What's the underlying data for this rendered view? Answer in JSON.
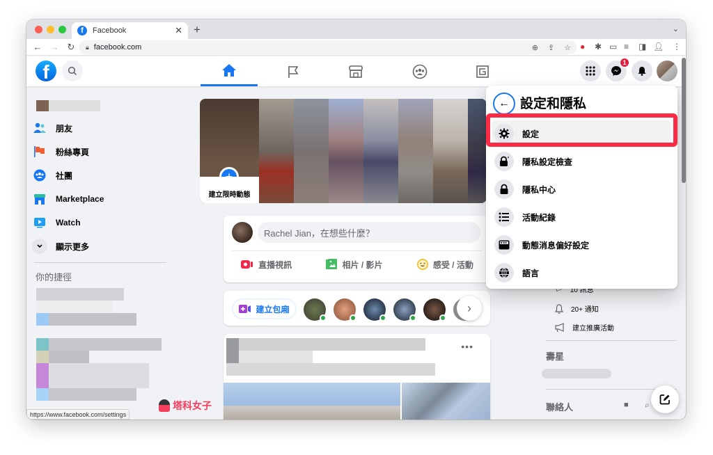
{
  "browser": {
    "tab_title": "Facebook",
    "url": "facebook.com",
    "status_url": "https://www.facebook.com/settings",
    "traffic_colors": [
      "#fe5f57",
      "#febc2e",
      "#28c840"
    ]
  },
  "header": {
    "nav_tabs": [
      {
        "name": "home",
        "active": true
      },
      {
        "name": "pages",
        "active": false
      },
      {
        "name": "marketplace",
        "active": false
      },
      {
        "name": "groups",
        "active": false
      },
      {
        "name": "gaming",
        "active": false
      }
    ],
    "messenger_badge": "1",
    "accent": "#1877f2"
  },
  "sidebar": {
    "items": [
      {
        "label": "朋友",
        "icon": "friends-icon"
      },
      {
        "label": "粉絲專頁",
        "icon": "flag-icon"
      },
      {
        "label": "社團",
        "icon": "groups-icon"
      },
      {
        "label": "Marketplace",
        "icon": "shop-icon"
      },
      {
        "label": "Watch",
        "icon": "watch-icon"
      },
      {
        "label": "顯示更多",
        "icon": "chevron-down-icon"
      }
    ],
    "shortcuts_title": "你的捷徑"
  },
  "stories": {
    "create_label": "建立限時動態"
  },
  "composer": {
    "placeholder": "Rachel Jian，在想些什麼？",
    "actions": [
      {
        "label": "直播視訊",
        "color": "#f02849"
      },
      {
        "label": "相片 / 影片",
        "color": "#45bd62"
      },
      {
        "label": "感受 / 活動",
        "color": "#f7b928"
      }
    ]
  },
  "rooms": {
    "create_label": "建立包廂"
  },
  "dropdown": {
    "title": "設定和隱私",
    "items": [
      {
        "label": "設定",
        "icon": "gear-icon",
        "selected": true
      },
      {
        "label": "隱私設定檢查",
        "icon": "lock-heart-icon",
        "selected": false
      },
      {
        "label": "隱私中心",
        "icon": "lock-icon",
        "selected": false
      },
      {
        "label": "活動紀錄",
        "icon": "list-icon",
        "selected": false
      },
      {
        "label": "動態消息偏好設定",
        "icon": "feed-icon",
        "selected": false
      },
      {
        "label": "語言",
        "icon": "globe-icon",
        "selected": false
      }
    ],
    "highlight_color": "#fc2a45"
  },
  "right": {
    "items": [
      {
        "label": "10 訊息",
        "icon": "message-icon"
      },
      {
        "label": "20+ 通知",
        "icon": "bell-icon"
      },
      {
        "label": "建立推廣活動",
        "icon": "megaphone-icon"
      }
    ],
    "birthdays_title": "壽星",
    "contacts_title": "聯絡人"
  },
  "watermark": {
    "text": "塔科女子"
  }
}
